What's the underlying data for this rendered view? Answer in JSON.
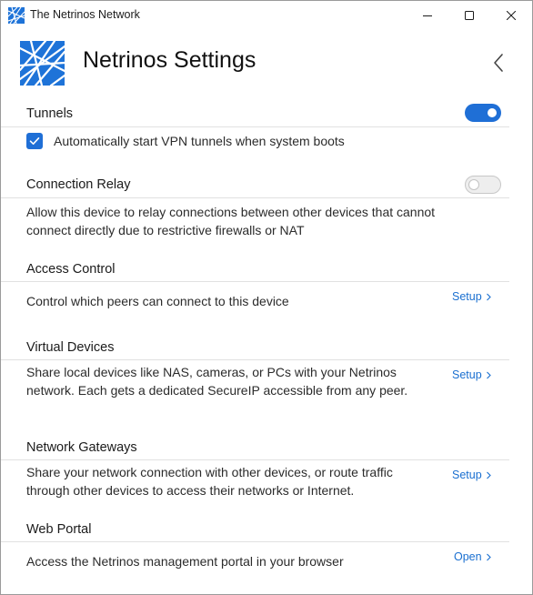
{
  "window": {
    "title": "The Netrinos Network"
  },
  "header": {
    "title": "Netrinos Settings"
  },
  "tunnels": {
    "title": "Tunnels",
    "enabled": true,
    "checkbox_label": "Automatically start VPN tunnels when system boots",
    "checkbox_checked": true
  },
  "connection_relay": {
    "title": "Connection Relay",
    "enabled": false,
    "description": "Allow this device to relay connections between other devices that cannot connect directly due to restrictive firewalls or NAT"
  },
  "access_control": {
    "title": "Access Control",
    "description": "Control which peers can connect to this device",
    "action": "Setup"
  },
  "virtual_devices": {
    "title": "Virtual Devices",
    "description": "Share local devices like NAS, cameras, or PCs with your Netrinos network. Each gets a dedicated SecureIP accessible from any peer.",
    "action": "Setup"
  },
  "network_gateways": {
    "title": "Network Gateways",
    "description": "Share your network connection with other devices, or route traffic through other devices to access their networks or Internet.",
    "action": "Setup"
  },
  "web_portal": {
    "title": "Web Portal",
    "description": "Access the Netrinos management portal in your browser",
    "action": "Open"
  },
  "colors": {
    "accent": "#1f6fd6",
    "link": "#1a6fd0",
    "logo_blue": "#1e73d8"
  }
}
